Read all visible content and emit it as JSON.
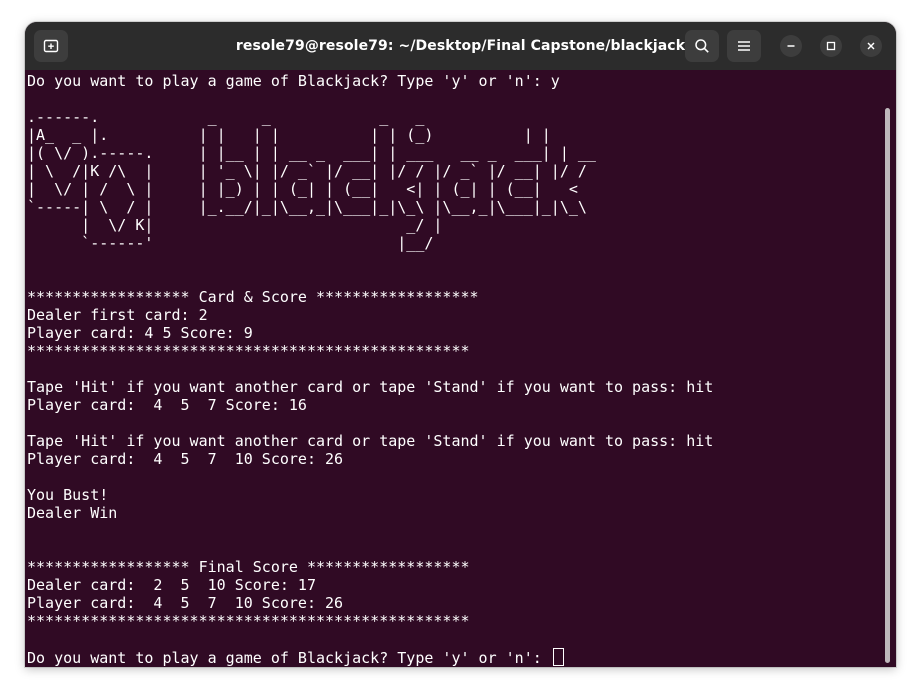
{
  "window": {
    "title": "resole79@resole79: ~/Desktop/Final Capstone/blackjack",
    "icons": {
      "new_tab": "new-tab-icon",
      "search": "search-icon",
      "menu": "hamburger-menu-icon",
      "minimize": "minimize-icon",
      "maximize": "maximize-icon",
      "close": "close-icon"
    },
    "colors": {
      "terminal_bg": "#300a24",
      "titlebar_bg": "#2c2c2c",
      "text": "#ffffff"
    }
  },
  "terminal": {
    "lines": [
      "Do you want to play a game of Blackjack? Type 'y' or 'n': y",
      "",
      ".------.            _     _            _   _       ",
      "|A_  _ |.          | |   | |          | | (_)          | |",
      "|( \\/ ).-----.     | |__ | | __ _  ___| | ___   __ _  ___| | __",
      "| \\  /|K /\\  |     | '_ \\| |/ _` |/ __| |/ / |/ _` |/ __| |/ /",
      "|  \\/ | /  \\ |     | |_) | | (_| | (__|   <| | (_| | (__|   <",
      "`-----| \\  / |     |_.__/|_|\\__,_|\\___|_|\\_\\ |\\__,_|\\___|_|\\_\\",
      "      |  \\/ K|                            _/ |",
      "      `------'                           |__/",
      "",
      "",
      "****************** Card & Score ******************",
      "Dealer first card: 2",
      "Player card: 4 5 Score: 9",
      "*************************************************",
      "",
      "Tape 'Hit' if you want another card or tape 'Stand' if you want to pass: hit",
      "Player card:  4  5  7 Score: 16",
      "",
      "Tape 'Hit' if you want another card or tape 'Stand' if you want to pass: hit",
      "Player card:  4  5  7  10 Score: 26",
      "",
      "You Bust!",
      "Dealer Win",
      "",
      "",
      "****************** Final Score ******************",
      "Dealer card:  2  5  10 Score: 17",
      "Player card:  4  5  7  10 Score: 26",
      "*************************************************",
      "",
      "Do you want to play a game of Blackjack? Type 'y' or 'n': "
    ]
  }
}
